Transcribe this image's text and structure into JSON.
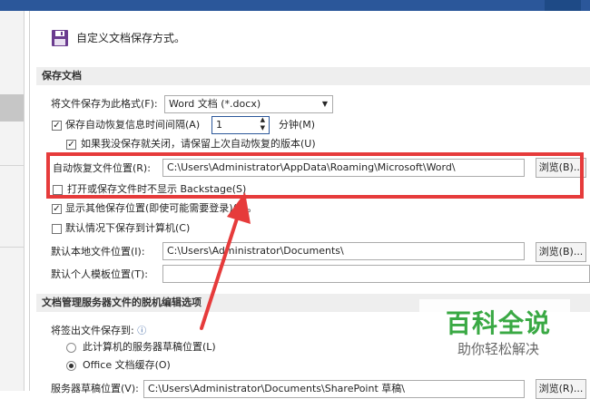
{
  "header": {
    "title": "自定义文档保存方式。"
  },
  "save": {
    "section": "保存文档",
    "format_label": "将文件保存为此格式(F):",
    "format_value": "Word 文档 (*.docx)",
    "autorecover_label": "保存自动恢复信息时间间隔(A)",
    "autorecover_value": "1",
    "minutes_label": "分钟(M)",
    "keep_last_label": "如果我没保存就关闭，请保留上次自动恢复的版本(U)",
    "autorecover_location_label": "自动恢复文件位置(R):",
    "autorecover_location_value": "C:\\Users\\Administrator\\AppData\\Roaming\\Microsoft\\Word\\",
    "browse1": "浏览(B)...",
    "no_backstage_label": "打开或保存文件时不显示 Backstage(S)",
    "show_additional_label": "显示其他保存位置(即使可能需要登录)(S)。",
    "default_computer_label": "默认情况下保存到计算机(C)",
    "default_local_label": "默认本地文件位置(I):",
    "default_local_value": "C:\\Users\\Administrator\\Documents\\",
    "browse2": "浏览(B)...",
    "default_template_label": "默认个人模板位置(T):",
    "default_template_value": ""
  },
  "offline": {
    "section": "文档管理服务器文件的脱机编辑选项",
    "save_to_label": "将签出文件保存到:",
    "info_icon": "ⓘ",
    "radio_server_label": "此计算机的服务器草稿位置(L)",
    "radio_office_label": "Office 文档缓存(O)",
    "server_drafts_label": "服务器草稿位置(V):",
    "server_drafts_value": "C:\\Users\\Administrator\\Documents\\SharePoint 草稿\\",
    "browse3": "浏览(R)..."
  },
  "watermark": {
    "title": "百科全说",
    "subtitle": "助你轻松解决"
  },
  "colors": {
    "accent": "#2b579a",
    "highlight_box": "#e63b3b",
    "arrow": "#e63b3b",
    "watermark_green": "#3aa944"
  }
}
